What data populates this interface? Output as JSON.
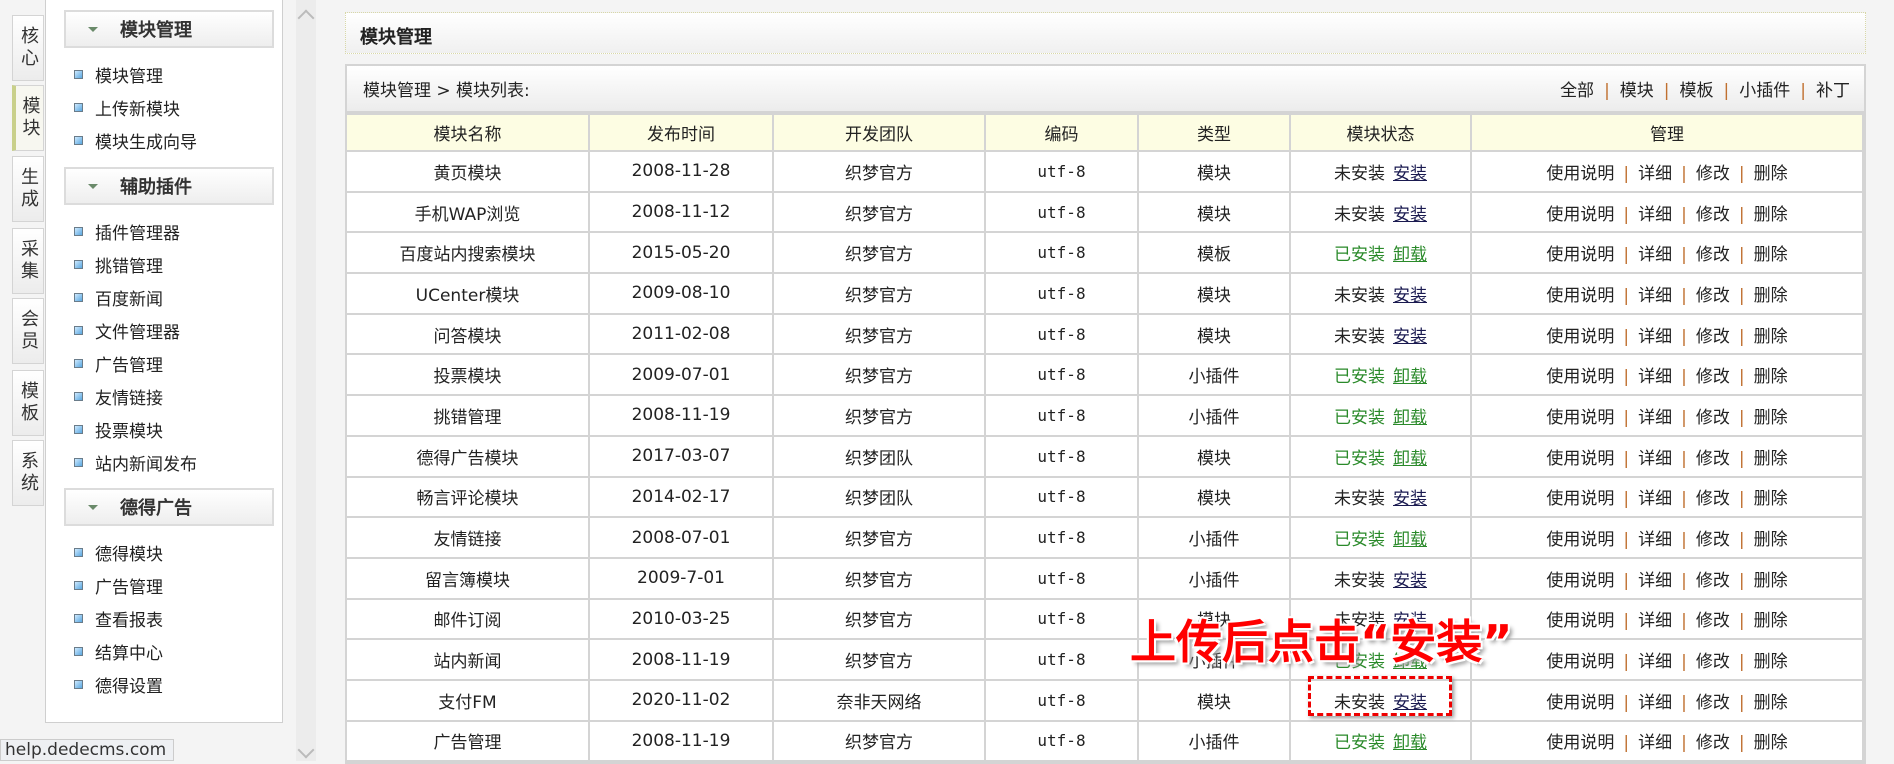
{
  "tabs": [
    "核心",
    "模块",
    "生成",
    "采集",
    "会员",
    "模板",
    "系统"
  ],
  "sidebar": {
    "sections": [
      {
        "title": "模块管理",
        "items": [
          "模块管理",
          "上传新模块",
          "模块生成向导"
        ]
      },
      {
        "title": "辅助插件",
        "items": [
          "插件管理器",
          "挑错管理",
          "百度新闻",
          "文件管理器",
          "广告管理",
          "友情链接",
          "投票模块",
          "站内新闻发布"
        ]
      },
      {
        "title": "德得广告",
        "items": [
          "德得模块",
          "广告管理",
          "查看报表",
          "结算中心",
          "德得设置"
        ]
      }
    ]
  },
  "status_bar": "help.dedecms.com",
  "page_title": "模块管理",
  "breadcrumb": "模块管理 > 模块列表:",
  "filters": [
    "全部",
    "模块",
    "模板",
    "小插件",
    "补丁"
  ],
  "columns": [
    "模块名称",
    "发布时间",
    "开发团队",
    "编码",
    "类型",
    "模块状态",
    "管理"
  ],
  "manage_links": [
    "使用说明",
    "详细",
    "修改",
    "删除"
  ],
  "rows": [
    {
      "name": "黄页模块",
      "date": "2008-11-28",
      "team": "织梦官方",
      "enc": "utf-8",
      "type": "模块",
      "state": "未安装",
      "action": "安装"
    },
    {
      "name": "手机WAP浏览",
      "date": "2008-11-12",
      "team": "织梦官方",
      "enc": "utf-8",
      "type": "模块",
      "state": "未安装",
      "action": "安装"
    },
    {
      "name": "百度站内搜索模块",
      "date": "2015-05-20",
      "team": "织梦官方",
      "enc": "utf-8",
      "type": "模板",
      "state": "已安装",
      "action": "卸载"
    },
    {
      "name": "UCenter模块",
      "date": "2009-08-10",
      "team": "织梦官方",
      "enc": "utf-8",
      "type": "模块",
      "state": "未安装",
      "action": "安装"
    },
    {
      "name": "问答模块",
      "date": "2011-02-08",
      "team": "织梦官方",
      "enc": "utf-8",
      "type": "模块",
      "state": "未安装",
      "action": "安装"
    },
    {
      "name": "投票模块",
      "date": "2009-07-01",
      "team": "织梦官方",
      "enc": "utf-8",
      "type": "小插件",
      "state": "已安装",
      "action": "卸载"
    },
    {
      "name": "挑错管理",
      "date": "2008-11-19",
      "team": "织梦官方",
      "enc": "utf-8",
      "type": "小插件",
      "state": "已安装",
      "action": "卸载"
    },
    {
      "name": "德得广告模块",
      "date": "2017-03-07",
      "team": "织梦团队",
      "enc": "utf-8",
      "type": "模块",
      "state": "已安装",
      "action": "卸载"
    },
    {
      "name": "畅言评论模块",
      "date": "2014-02-17",
      "team": "织梦团队",
      "enc": "utf-8",
      "type": "模块",
      "state": "未安装",
      "action": "安装"
    },
    {
      "name": "友情链接",
      "date": "2008-07-01",
      "team": "织梦官方",
      "enc": "utf-8",
      "type": "小插件",
      "state": "已安装",
      "action": "卸载"
    },
    {
      "name": "留言簿模块",
      "date": "2009-7-01",
      "team": "织梦官方",
      "enc": "utf-8",
      "type": "小插件",
      "state": "未安装",
      "action": "安装"
    },
    {
      "name": "邮件订阅",
      "date": "2010-03-25",
      "team": "织梦官方",
      "enc": "utf-8",
      "type": "模块",
      "state": "未安装",
      "action": "安装"
    },
    {
      "name": "站内新闻",
      "date": "2008-11-19",
      "team": "织梦官方",
      "enc": "utf-8",
      "type": "小插件",
      "state": "已安装",
      "action": "卸载"
    },
    {
      "name": "支付FM",
      "date": "2020-11-02",
      "team": "奈非天网络",
      "enc": "utf-8",
      "type": "模块",
      "state": "未安装",
      "action": "安装"
    },
    {
      "name": "广告管理",
      "date": "2008-11-19",
      "team": "织梦官方",
      "enc": "utf-8",
      "type": "小插件",
      "state": "已安装",
      "action": "卸载"
    }
  ],
  "annotation": "上传后点击“安装”",
  "colors": {
    "installed": "#2a8a2a",
    "header_bg": "#fdfde3",
    "annotation": "#ff0000"
  }
}
